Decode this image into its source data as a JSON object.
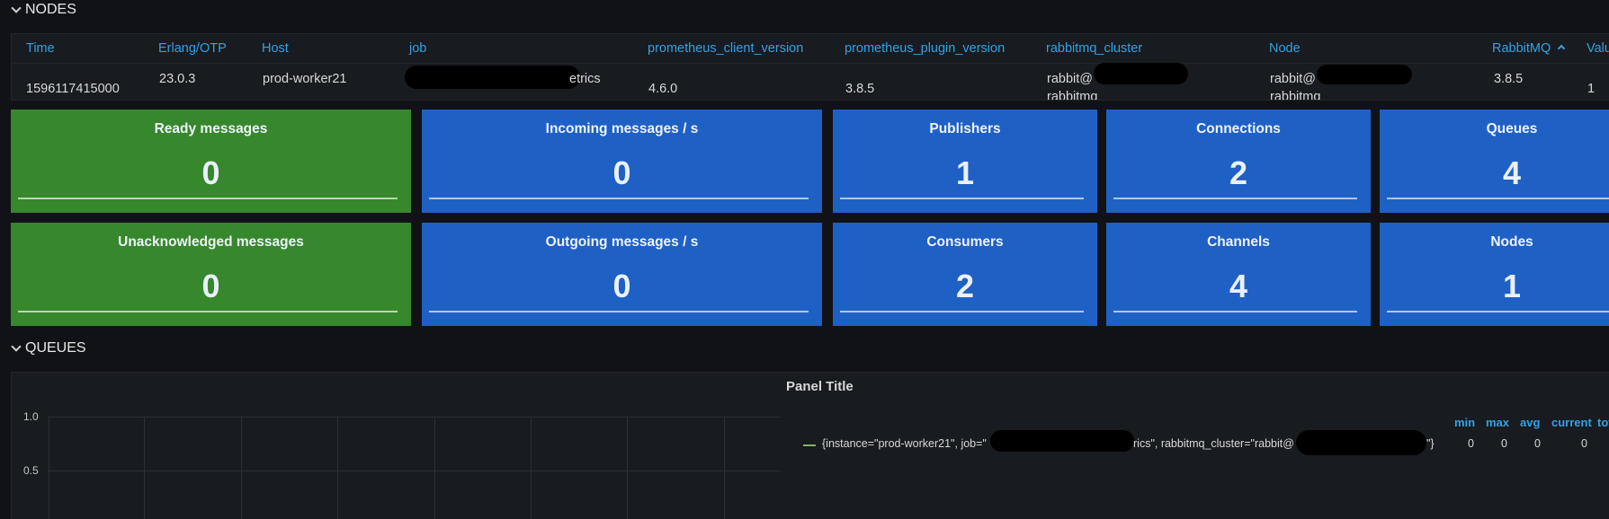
{
  "nodes_row": {
    "label": "NODES"
  },
  "queues_row": {
    "label": "QUEUES"
  },
  "table": {
    "columns": [
      "Time",
      "Erlang/OTP",
      "Host",
      "job",
      "prometheus_client_version",
      "prometheus_plugin_version",
      "rabbitmq_cluster",
      "Node",
      "RabbitMQ",
      "Valu"
    ],
    "row": {
      "time": "1596117415000",
      "erlang": "23.0.3",
      "host": "prod-worker21",
      "job": "etrics",
      "client_version": "4.6.0",
      "plugin_version": "3.8.5",
      "cluster": "rabbit@",
      "cluster_cut": "rabbitmq",
      "node": "rabbit@",
      "node_cut": "rabbitmq",
      "rabbitmq": "3.8.5",
      "value": "1"
    }
  },
  "stats": [
    {
      "title": "Ready messages",
      "value": "0",
      "color": "#37872d"
    },
    {
      "title": "Incoming messages / s",
      "value": "0",
      "color": "#1f60c4"
    },
    {
      "title": "Publishers",
      "value": "1",
      "color": "#1f60c4"
    },
    {
      "title": "Connections",
      "value": "2",
      "color": "#1f60c4"
    },
    {
      "title": "Queues",
      "value": "4",
      "color": "#1f60c4"
    },
    {
      "title": "Unacknowledged messages",
      "value": "0",
      "color": "#37872d"
    },
    {
      "title": "Outgoing messages / s",
      "value": "0",
      "color": "#1f60c4"
    },
    {
      "title": "Consumers",
      "value": "2",
      "color": "#1f60c4"
    },
    {
      "title": "Channels",
      "value": "4",
      "color": "#1f60c4"
    },
    {
      "title": "Nodes",
      "value": "1",
      "color": "#1f60c4"
    }
  ],
  "graph": {
    "title": "Panel Title",
    "y_ticks": [
      "1.0",
      "0.5"
    ],
    "legend": {
      "headers": [
        "min",
        "max",
        "avg",
        "current",
        "tot"
      ],
      "series": {
        "part1": "{instance=\"prod-worker21\", job=\"",
        "part2": "rics\", rabbitmq_cluster=\"rabbit@",
        "part3": "\"}",
        "min": "0",
        "max": "0",
        "avg": "0",
        "current": "0",
        "color": "#7eb26d"
      }
    }
  }
}
